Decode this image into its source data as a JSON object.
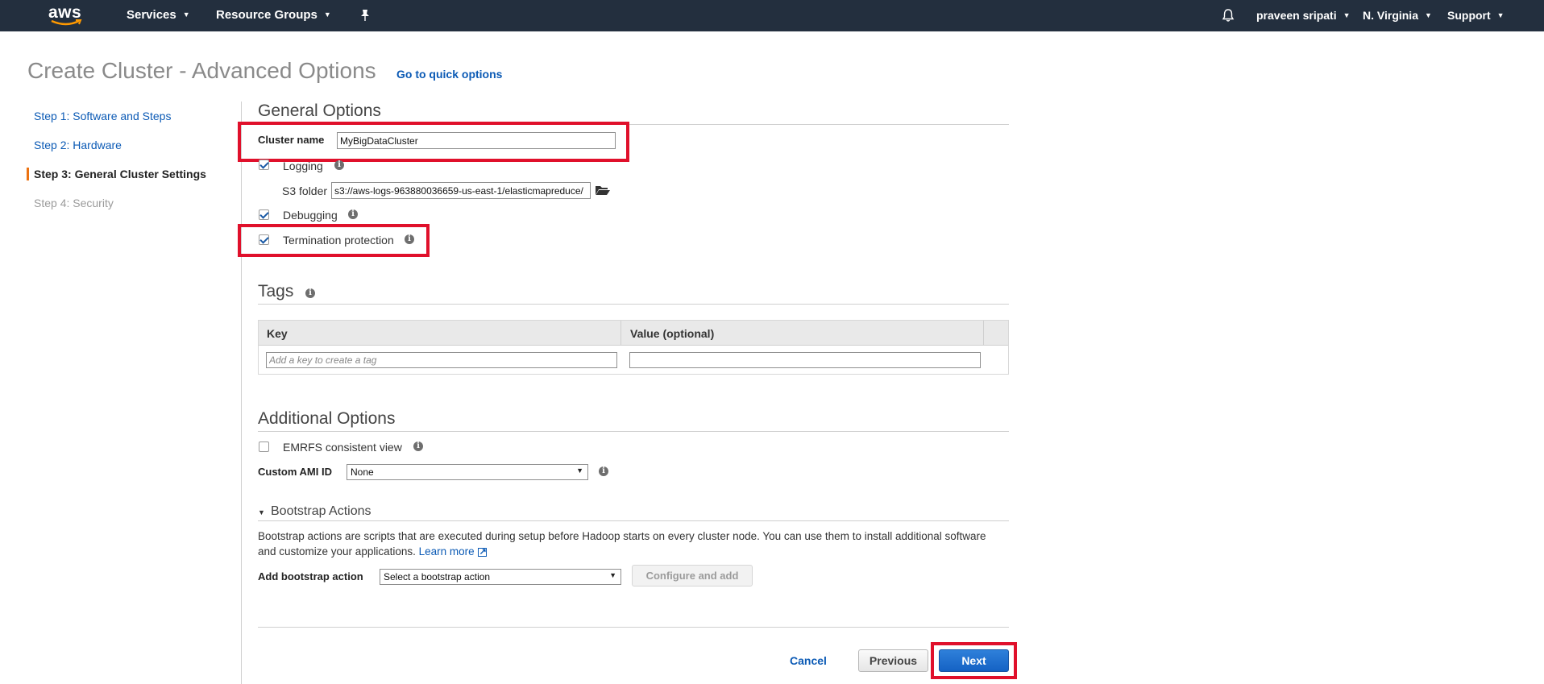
{
  "nav": {
    "logo": "aws",
    "services": "Services",
    "resource_groups": "Resource Groups",
    "user": "praveen sripati",
    "region": "N. Virginia",
    "support": "Support"
  },
  "page": {
    "title": "Create Cluster - Advanced Options",
    "quick_options_link": "Go to quick options"
  },
  "steps": [
    {
      "label": "Step 1: Software and Steps",
      "state": "link"
    },
    {
      "label": "Step 2: Hardware",
      "state": "link"
    },
    {
      "label": "Step 3: General Cluster Settings",
      "state": "active"
    },
    {
      "label": "Step 4: Security",
      "state": "disabled"
    }
  ],
  "general": {
    "heading": "General Options",
    "cluster_name_label": "Cluster name",
    "cluster_name_value": "MyBigDataCluster",
    "logging_label": "Logging",
    "logging_checked": true,
    "s3_folder_label": "S3 folder",
    "s3_folder_value": "s3://aws-logs-963880036659-us-east-1/elasticmapreduce/",
    "debugging_label": "Debugging",
    "debugging_checked": true,
    "termination_label": "Termination protection",
    "termination_checked": true
  },
  "tags": {
    "heading": "Tags",
    "col_key": "Key",
    "col_value": "Value (optional)",
    "key_placeholder": "Add a key to create a tag",
    "value_value": ""
  },
  "additional": {
    "heading": "Additional Options",
    "emrfs_label": "EMRFS consistent view",
    "emrfs_checked": false,
    "custom_ami_label": "Custom AMI ID",
    "custom_ami_value": "None"
  },
  "bootstrap": {
    "heading": "Bootstrap Actions",
    "description": "Bootstrap actions are scripts that are executed during setup before Hadoop starts on every cluster node. You can use them to install additional software and customize your applications.",
    "learn_more": "Learn more",
    "add_label": "Add bootstrap action",
    "select_value": "Select a bootstrap action",
    "configure_button": "Configure and add"
  },
  "footer": {
    "cancel": "Cancel",
    "previous": "Previous",
    "next": "Next"
  },
  "colors": {
    "nav_bg": "#232f3e",
    "link": "#0b5ab5",
    "highlight": "#e0102b",
    "primary_button": "#1562c4",
    "active_step_bar": "#ec7211"
  }
}
